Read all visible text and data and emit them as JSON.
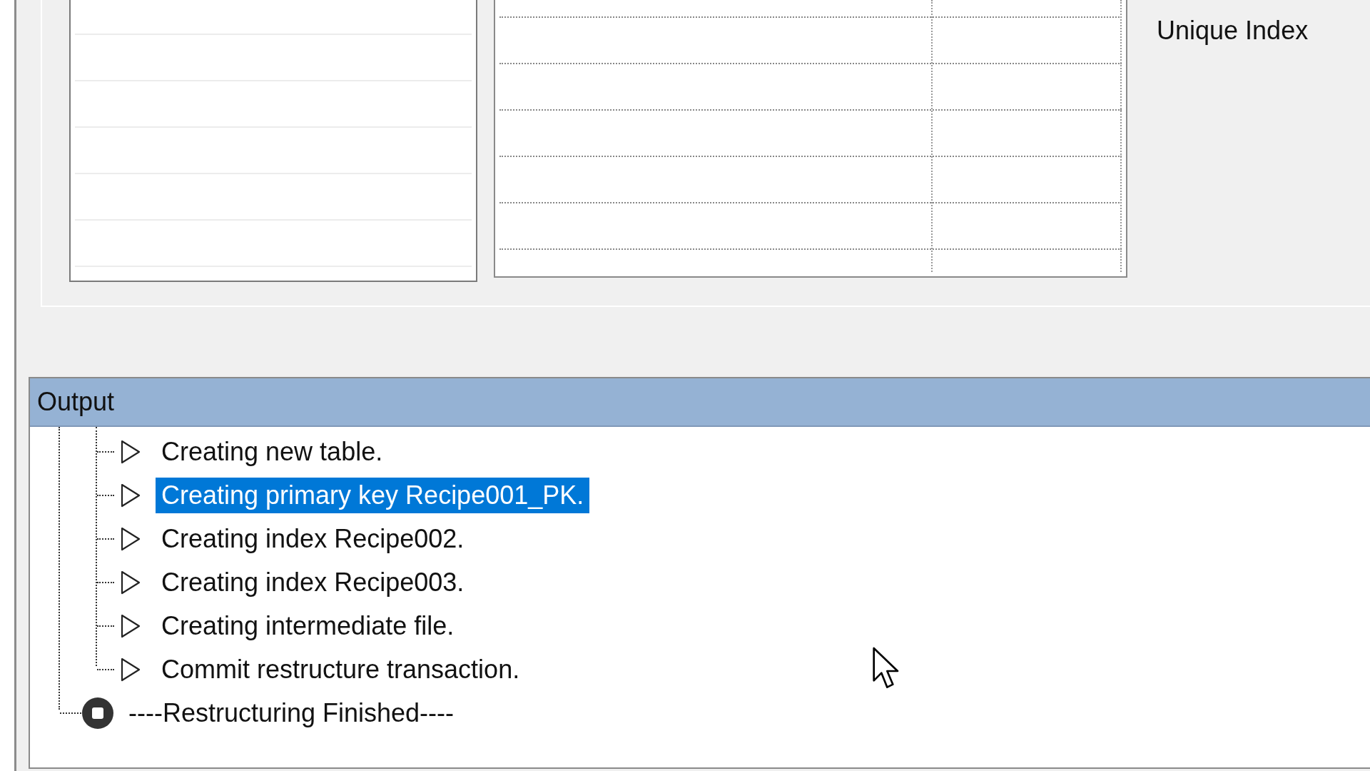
{
  "index_panel": {
    "label": "Unique Index"
  },
  "output": {
    "title": "Output",
    "tree": [
      {
        "children": [
          {
            "label": "Creating new table.",
            "kind": "step",
            "selected": false
          },
          {
            "label": "Creating primary key Recipe001_PK.",
            "kind": "step",
            "selected": true
          },
          {
            "label": "Creating index Recipe002.",
            "kind": "step",
            "selected": false
          },
          {
            "label": "Creating index Recipe003.",
            "kind": "step",
            "selected": false
          },
          {
            "label": "Creating intermediate file.",
            "kind": "step",
            "selected": false
          },
          {
            "label": "Commit restructure transaction.",
            "kind": "step",
            "selected": false
          }
        ]
      },
      {
        "label": "----Restructuring Finished----",
        "kind": "end",
        "selected": false
      }
    ]
  }
}
